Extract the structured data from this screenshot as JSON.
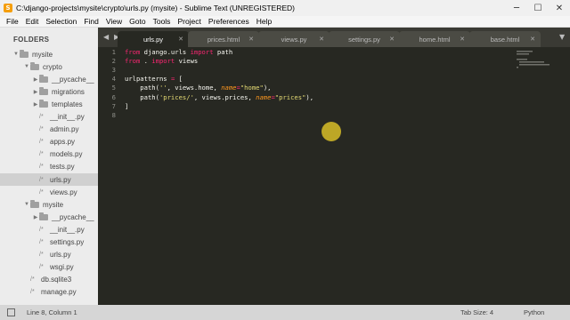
{
  "window": {
    "title": "C:\\django-projects\\mysite\\crypto\\urls.py (mysite) - Sublime Text (UNREGISTERED)",
    "minimize": "─",
    "maximize": "☐",
    "close": "✕",
    "app_icon": "S"
  },
  "menu": [
    "File",
    "Edit",
    "Selection",
    "Find",
    "View",
    "Goto",
    "Tools",
    "Project",
    "Preferences",
    "Help"
  ],
  "sidebar": {
    "header": "FOLDERS",
    "items": [
      {
        "type": "folder",
        "label": "mysite",
        "open": true,
        "depth": 0
      },
      {
        "type": "folder",
        "label": "crypto",
        "open": true,
        "depth": 1
      },
      {
        "type": "folder",
        "label": "__pycache__",
        "open": false,
        "depth": 2
      },
      {
        "type": "folder",
        "label": "migrations",
        "open": false,
        "depth": 2
      },
      {
        "type": "folder",
        "label": "templates",
        "open": false,
        "depth": 2
      },
      {
        "type": "file",
        "label": "__init__.py",
        "depth": 2
      },
      {
        "type": "file",
        "label": "admin.py",
        "depth": 2
      },
      {
        "type": "file",
        "label": "apps.py",
        "depth": 2
      },
      {
        "type": "file",
        "label": "models.py",
        "depth": 2
      },
      {
        "type": "file",
        "label": "tests.py",
        "depth": 2
      },
      {
        "type": "file",
        "label": "urls.py",
        "depth": 2,
        "selected": true
      },
      {
        "type": "file",
        "label": "views.py",
        "depth": 2
      },
      {
        "type": "folder",
        "label": "mysite",
        "open": true,
        "depth": 1
      },
      {
        "type": "folder",
        "label": "__pycache__",
        "open": false,
        "depth": 2
      },
      {
        "type": "file",
        "label": "__init__.py",
        "depth": 2
      },
      {
        "type": "file",
        "label": "settings.py",
        "depth": 2
      },
      {
        "type": "file",
        "label": "urls.py",
        "depth": 2
      },
      {
        "type": "file",
        "label": "wsgi.py",
        "depth": 2
      },
      {
        "type": "file",
        "label": "db.sqlite3",
        "depth": 1
      },
      {
        "type": "file",
        "label": "manage.py",
        "depth": 1
      }
    ]
  },
  "tabs": [
    {
      "label": "urls.py",
      "active": true
    },
    {
      "label": "prices.html",
      "active": false
    },
    {
      "label": "views.py",
      "active": false
    },
    {
      "label": "settings.py",
      "active": false
    },
    {
      "label": "home.html",
      "active": false
    },
    {
      "label": "base.html",
      "active": false
    }
  ],
  "tab_nav": {
    "left": "◀",
    "right": "▶",
    "overflow": "▼"
  },
  "editor": {
    "lines": [
      [
        {
          "t": "from",
          "c": "kw"
        },
        {
          "t": " django.urls ",
          "c": ""
        },
        {
          "t": "import",
          "c": "kw"
        },
        {
          "t": " path",
          "c": ""
        }
      ],
      [
        {
          "t": "from",
          "c": "kw"
        },
        {
          "t": " . ",
          "c": ""
        },
        {
          "t": "import",
          "c": "kw"
        },
        {
          "t": " views",
          "c": ""
        }
      ],
      [],
      [
        {
          "t": "urlpatterns ",
          "c": ""
        },
        {
          "t": "=",
          "c": "kw"
        },
        {
          "t": " [",
          "c": ""
        }
      ],
      [
        {
          "t": "    path(",
          "c": ""
        },
        {
          "t": "''",
          "c": "str"
        },
        {
          "t": ", views.home, ",
          "c": ""
        },
        {
          "t": "name",
          "c": "arg"
        },
        {
          "t": "=",
          "c": "kw"
        },
        {
          "t": "\"home\"",
          "c": "str"
        },
        {
          "t": "),",
          "c": ""
        }
      ],
      [
        {
          "t": "    path(",
          "c": ""
        },
        {
          "t": "'prices/'",
          "c": "str"
        },
        {
          "t": ", views.prices, ",
          "c": ""
        },
        {
          "t": "name",
          "c": "arg"
        },
        {
          "t": "=",
          "c": "kw"
        },
        {
          "t": "\"prices\"",
          "c": "str"
        },
        {
          "t": "),",
          "c": ""
        }
      ],
      [
        {
          "t": "]",
          "c": ""
        }
      ],
      []
    ]
  },
  "status": {
    "position": "Line 8, Column 1",
    "tab_size": "Tab Size: 4",
    "syntax": "Python"
  },
  "colors": {
    "editor_bg": "#272822",
    "keyword": "#f92672",
    "string": "#e6db74",
    "argument": "#fd971f",
    "cursor_highlight": "#f0d228"
  }
}
